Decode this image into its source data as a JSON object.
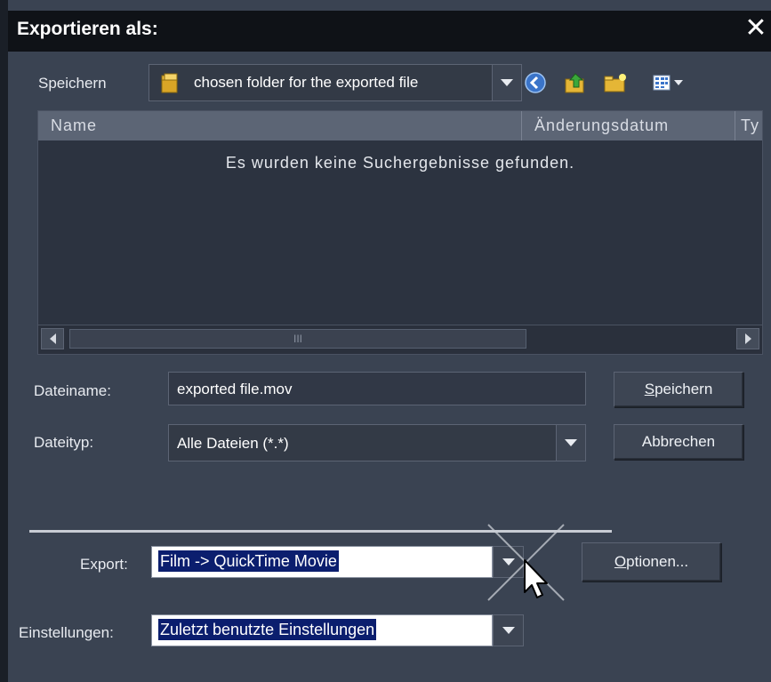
{
  "dialog": {
    "title": "Exportieren als:",
    "close_label": "✕"
  },
  "save_in": {
    "label": "Speichern",
    "folder": "chosen folder for the exported file"
  },
  "toolbar": {
    "icons": [
      "back-icon",
      "up-folder-icon",
      "new-folder-icon",
      "view-menu-icon"
    ]
  },
  "file_list": {
    "columns": [
      "Name",
      "Änderungsdatum",
      "Ty"
    ],
    "empty_message": "Es wurden keine Suchergebnisse gefunden.",
    "scroll_grip": "III"
  },
  "filename": {
    "label": "Dateiname:",
    "value": "exported file.mov"
  },
  "filetype": {
    "label": "Dateityp:",
    "value": "Alle Dateien (*.*)"
  },
  "buttons": {
    "save_mnemonic": "S",
    "save_rest": "peichern",
    "cancel": "Abbrechen",
    "options_mnemonic": "O",
    "options_rest": "ptionen..."
  },
  "export": {
    "label": "Export:",
    "value": "Film -> QuickTime Movie"
  },
  "settings": {
    "label": "Einstellungen:",
    "value": "Zuletzt benutzte Einstellungen"
  },
  "colors": {
    "dialog_bg": "#3a4352",
    "titlebar": "#0f1217",
    "selection": "#0b1e6e",
    "header": "#5c6575"
  }
}
